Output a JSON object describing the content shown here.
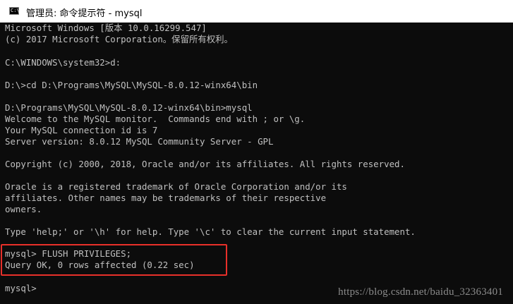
{
  "window": {
    "icon_text": "C:\\",
    "title": "管理员: 命令提示符 - mysql"
  },
  "console": {
    "lines": [
      "Microsoft Windows [版本 10.0.16299.547]",
      "(c) 2017 Microsoft Corporation。保留所有权利。",
      "C:\\WINDOWS\\system32>d:",
      "D:\\>cd D:\\Programs\\MySQL\\MySQL-8.0.12-winx64\\bin",
      "D:\\Programs\\MySQL\\MySQL-8.0.12-winx64\\bin>mysql",
      "Welcome to the MySQL monitor.  Commands end with ; or \\g.",
      "Your MySQL connection id is 7",
      "Server version: 8.0.12 MySQL Community Server - GPL",
      "Copyright (c) 2000, 2018, Oracle and/or its affiliates. All rights reserved.",
      "Oracle is a registered trademark of Oracle Corporation and/or its",
      "affiliates. Other names may be trademarks of their respective",
      "owners.",
      "Type 'help;' or '\\h' for help. Type '\\c' to clear the current input statement.",
      "mysql> FLUSH PRIVILEGES;",
      "Query OK, 0 rows affected (0.22 sec)",
      "mysql>"
    ]
  },
  "watermark": "https://blog.csdn.net/baidu_32363401",
  "colors": {
    "console_background": "#0c0c0c",
    "console_text": "#c0c0c0",
    "highlight_border": "#e8302a"
  }
}
